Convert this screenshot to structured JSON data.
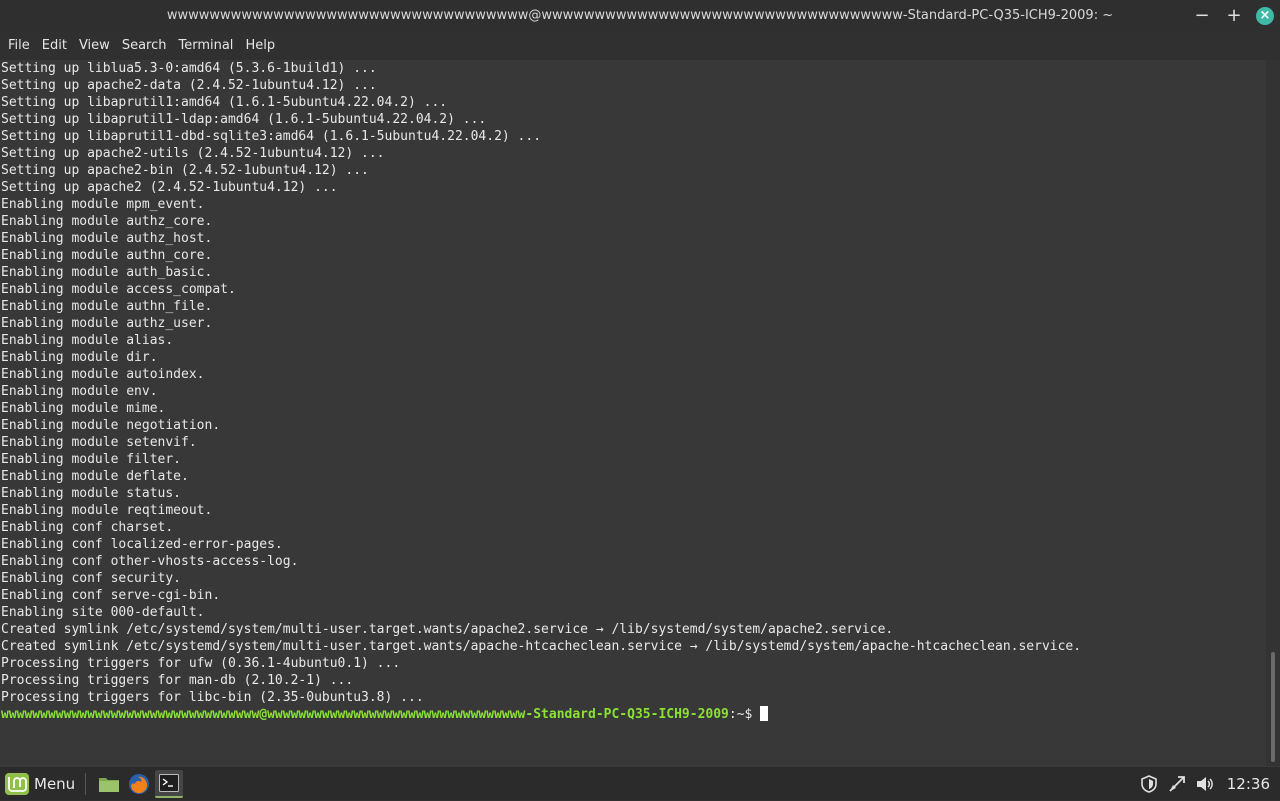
{
  "window": {
    "title": "wwwwwwwwwwwwwwwwwwwwwwwwwwwwwwwwww@wwwwwwwwwwwwwwwwwwwwwwwwwwwwwwwwww-Standard-PC-Q35-ICH9-2009: ~",
    "minimize_glyph": "−",
    "maximize_glyph": "+",
    "close_glyph": "×"
  },
  "menubar": {
    "items": [
      "File",
      "Edit",
      "View",
      "Search",
      "Terminal",
      "Help"
    ]
  },
  "terminal": {
    "lines": [
      "Setting up liblua5.3-0:amd64 (5.3.6-1build1) ...",
      "Setting up apache2-data (2.4.52-1ubuntu4.12) ...",
      "Setting up libaprutil1:amd64 (1.6.1-5ubuntu4.22.04.2) ...",
      "Setting up libaprutil1-ldap:amd64 (1.6.1-5ubuntu4.22.04.2) ...",
      "Setting up libaprutil1-dbd-sqlite3:amd64 (1.6.1-5ubuntu4.22.04.2) ...",
      "Setting up apache2-utils (2.4.52-1ubuntu4.12) ...",
      "Setting up apache2-bin (2.4.52-1ubuntu4.12) ...",
      "Setting up apache2 (2.4.52-1ubuntu4.12) ...",
      "Enabling module mpm_event.",
      "Enabling module authz_core.",
      "Enabling module authz_host.",
      "Enabling module authn_core.",
      "Enabling module auth_basic.",
      "Enabling module access_compat.",
      "Enabling module authn_file.",
      "Enabling module authz_user.",
      "Enabling module alias.",
      "Enabling module dir.",
      "Enabling module autoindex.",
      "Enabling module env.",
      "Enabling module mime.",
      "Enabling module negotiation.",
      "Enabling module setenvif.",
      "Enabling module filter.",
      "Enabling module deflate.",
      "Enabling module status.",
      "Enabling module reqtimeout.",
      "Enabling conf charset.",
      "Enabling conf localized-error-pages.",
      "Enabling conf other-vhosts-access-log.",
      "Enabling conf security.",
      "Enabling conf serve-cgi-bin.",
      "Enabling site 000-default.",
      "Created symlink /etc/systemd/system/multi-user.target.wants/apache2.service → /lib/systemd/system/apache2.service.",
      "Created symlink /etc/systemd/system/multi-user.target.wants/apache-htcacheclean.service → /lib/systemd/system/apache-htcacheclean.service.",
      "Processing triggers for ufw (0.36.1-4ubuntu0.1) ...",
      "Processing triggers for man-db (2.10.2-1) ...",
      "Processing triggers for libc-bin (2.35-0ubuntu3.8) ..."
    ],
    "prompt_user_host": "wwwwwwwwwwwwwwwwwwwwwwwwwwwwwwwww@wwwwwwwwwwwwwwwwwwwwwwwwwwwwwwwww-Standard-PC-Q35-ICH9-2009",
    "prompt_path": ":~$ ",
    "prompt_color": "#8ae234"
  },
  "taskbar": {
    "menu_label": "Menu",
    "launchers": [
      "folder-icon",
      "firefox-icon",
      "terminal-icon"
    ],
    "tray_icons": [
      "shield-icon",
      "network-icon",
      "volume-icon"
    ],
    "clock": "12:36"
  }
}
